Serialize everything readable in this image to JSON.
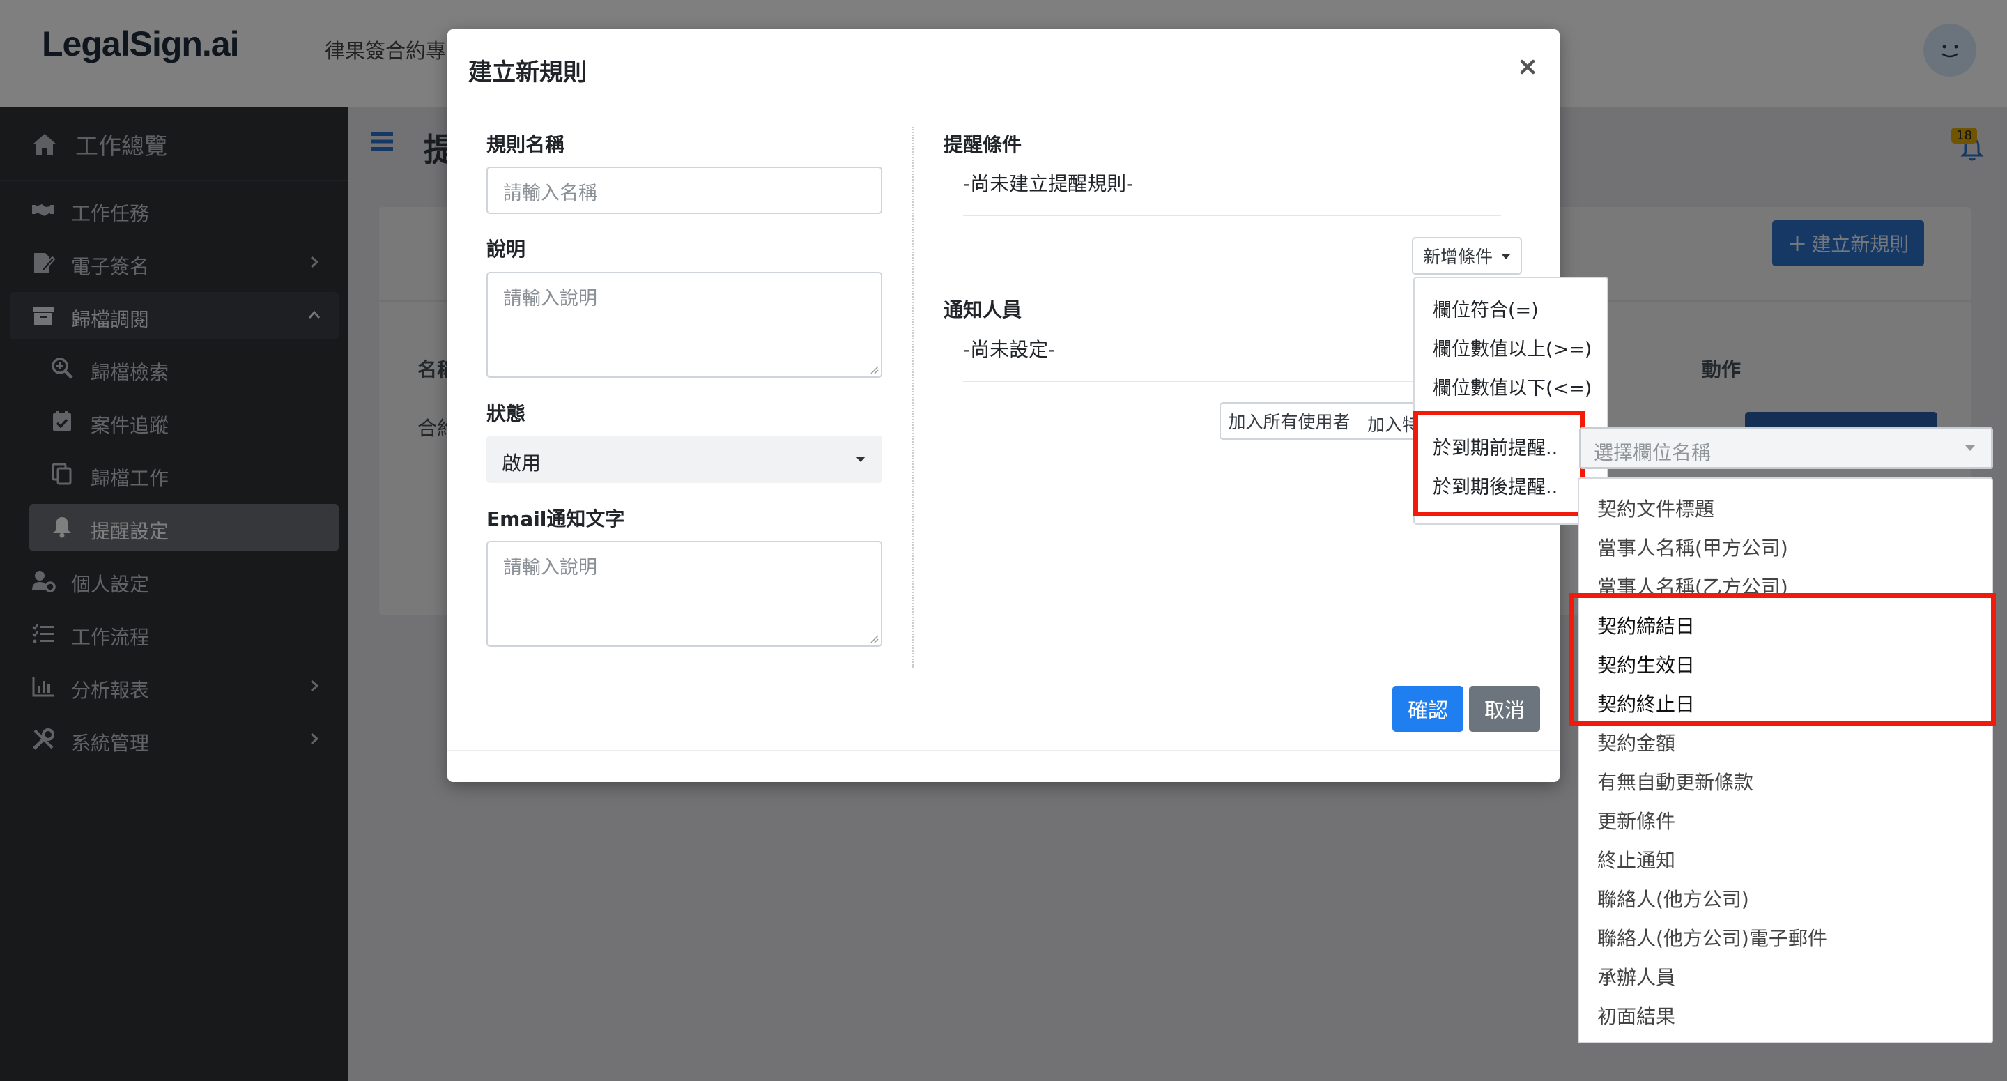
{
  "topbar": {
    "logo": "LegalSign.ai",
    "title": "律果簽合約專業",
    "avatar_icon": "smiley-face-icon"
  },
  "sidebar": {
    "brand": {
      "label": "工作總覽",
      "icon": "home-icon"
    },
    "items": [
      {
        "label": "工作任務",
        "icon": "handshake-icon",
        "chevron": false
      },
      {
        "label": "電子簽名",
        "icon": "signature-icon",
        "chevron": true
      },
      {
        "label": "歸檔調閱",
        "icon": "archive-icon",
        "chevron": true,
        "open": true
      },
      {
        "label": "個人設定",
        "icon": "user-gear-icon",
        "chevron": false
      },
      {
        "label": "工作流程",
        "icon": "tasks-icon",
        "chevron": false
      },
      {
        "label": "分析報表",
        "icon": "chart-icon",
        "chevron": true
      },
      {
        "label": "系統管理",
        "icon": "tools-icon",
        "chevron": true
      }
    ],
    "subitems": [
      {
        "label": "歸檔檢索",
        "icon": "search-plus-icon"
      },
      {
        "label": "案件追蹤",
        "icon": "calendar-check-icon"
      },
      {
        "label": "歸檔工作",
        "icon": "copy-icon"
      },
      {
        "label": "提醒設定",
        "icon": "bell-icon",
        "active": true
      }
    ]
  },
  "content": {
    "page_title": "提",
    "notification_count": "18",
    "new_rule_button": "建立新規則",
    "table_header_name": "名稱",
    "table_header_action": "動作",
    "table_first_cell": "合約"
  },
  "modal": {
    "title": "建立新規則",
    "rule_name_label": "規則名稱",
    "rule_name_placeholder": "請輸入名稱",
    "description_label": "說明",
    "description_placeholder": "請輸入說明",
    "status_label": "狀態",
    "status_value": "啟用",
    "email_label": "Email通知文字",
    "email_placeholder": "請輸入說明",
    "conditions_label": "提醒條件",
    "conditions_empty": "-尚未建立提醒規則-",
    "add_condition_button": "新增條件",
    "notify_label": "通知人員",
    "notify_empty": "-尚未設定-",
    "add_all_users_button": "加入所有使用者",
    "add_specific_button": "加入特定",
    "confirm_button": "確認",
    "cancel_button": "取消"
  },
  "condition_menu": {
    "items": [
      "欄位符合(=)",
      "欄位數值以上(>=)",
      "欄位數值以下(<=)",
      "於到期前提醒..",
      "於到期後提醒.."
    ]
  },
  "field_select": {
    "placeholder": "選擇欄位名稱",
    "options": [
      "契約文件標題",
      "當事人名稱(甲方公司)",
      "當事人名稱(乙方公司)",
      "契約締結日",
      "契約生效日",
      "契約終止日",
      "契約金額",
      "有無自動更新條款",
      "更新條件",
      "終止通知",
      "聯絡人(他方公司)",
      "聯絡人(他方公司)電子郵件",
      "承辦人員",
      "初面結果"
    ]
  },
  "colors": {
    "sidebar_bg": "#2e3236",
    "primary": "#1f7ef0",
    "secondary": "#6c757d",
    "highlight": "#f21a0a"
  }
}
